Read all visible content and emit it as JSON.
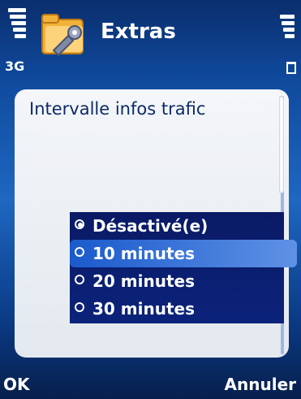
{
  "status_bar": {
    "network_label": "3G",
    "signal_bars": 5,
    "battery_bars": 4
  },
  "app": {
    "title": "Extras",
    "icon": "folder-wrench-icon"
  },
  "dialog": {
    "title": "Intervalle infos trafic",
    "options": [
      {
        "label": "Désactivé(e)",
        "checked": true
      },
      {
        "label": "10 minutes",
        "checked": false
      },
      {
        "label": "20 minutes",
        "checked": false
      },
      {
        "label": "30 minutes",
        "checked": false
      }
    ],
    "highlighted_index": 1
  },
  "softkeys": {
    "left": "OK",
    "right": "Annuler"
  },
  "colors": {
    "background": "#0f4a9d",
    "highlight": "#5f92e6",
    "text": "#ffffff"
  }
}
